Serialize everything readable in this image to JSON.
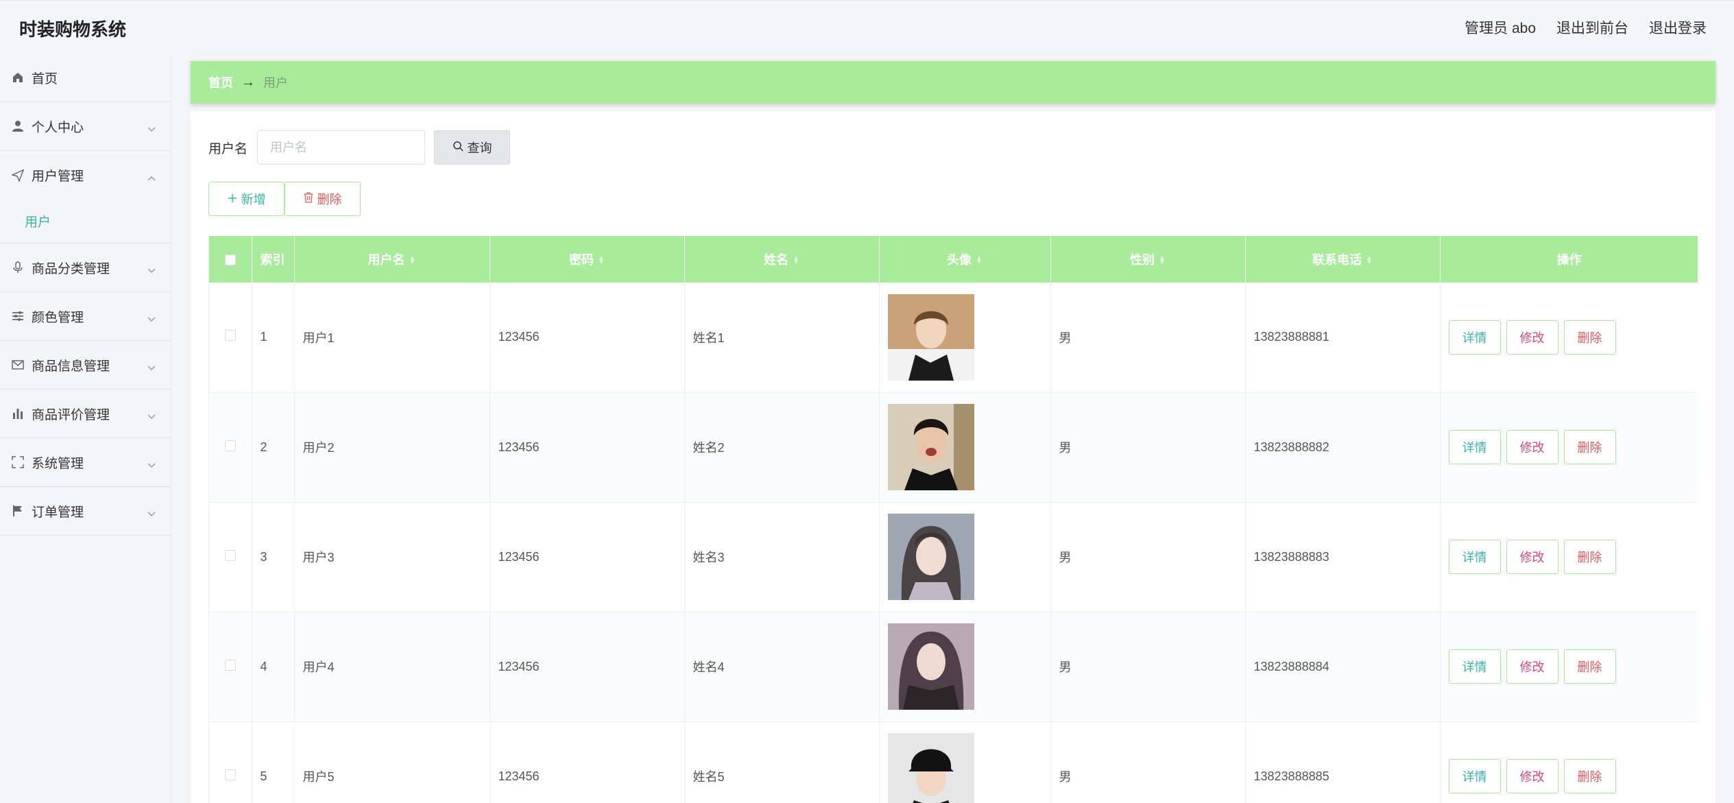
{
  "header": {
    "title": "时装购物系统",
    "admin_label": "管理员 abo",
    "to_front_label": "退出到前台",
    "logout_label": "退出登录"
  },
  "sidebar": {
    "items": [
      {
        "label": "首页",
        "icon": "home-icon"
      },
      {
        "label": "个人中心",
        "icon": "user-icon"
      },
      {
        "label": "用户管理",
        "icon": "send-icon",
        "expanded": true,
        "children": [
          {
            "label": "用户",
            "active": true
          }
        ]
      },
      {
        "label": "商品分类管理",
        "icon": "microphone-icon"
      },
      {
        "label": "颜色管理",
        "icon": "filter-lines-icon"
      },
      {
        "label": "商品信息管理",
        "icon": "mail-icon"
      },
      {
        "label": "商品评价管理",
        "icon": "bar-chart-icon"
      },
      {
        "label": "系统管理",
        "icon": "fullscreen-icon"
      },
      {
        "label": "订单管理",
        "icon": "flag-icon"
      }
    ]
  },
  "breadcrumb": {
    "home": "首页",
    "arrow": "→",
    "current": "用户"
  },
  "search": {
    "label": "用户名",
    "placeholder": "用户名",
    "value": "",
    "button_label": "查询"
  },
  "actions": {
    "add_label": "新增",
    "delete_label": "删除"
  },
  "table": {
    "columns": [
      "索引",
      "用户名",
      "密码",
      "姓名",
      "头像",
      "性别",
      "联系电话",
      "操作"
    ],
    "rows": [
      {
        "index": "1",
        "username": "用户1",
        "password": "123456",
        "name": "姓名1",
        "gender": "男",
        "phone": "13823888881"
      },
      {
        "index": "2",
        "username": "用户2",
        "password": "123456",
        "name": "姓名2",
        "gender": "男",
        "phone": "13823888882"
      },
      {
        "index": "3",
        "username": "用户3",
        "password": "123456",
        "name": "姓名3",
        "gender": "男",
        "phone": "13823888883"
      },
      {
        "index": "4",
        "username": "用户4",
        "password": "123456",
        "name": "姓名4",
        "gender": "男",
        "phone": "13823888884"
      },
      {
        "index": "5",
        "username": "用户5",
        "password": "123456",
        "name": "姓名5",
        "gender": "男",
        "phone": "13823888885"
      }
    ],
    "row_actions": {
      "detail": "详情",
      "edit": "修改",
      "delete": "删除"
    }
  },
  "colors": {
    "accent_green": "#a8ec9b",
    "teal_text": "#37b5a5",
    "pink_text": "#e2457a",
    "red_text": "#e25a5a"
  }
}
